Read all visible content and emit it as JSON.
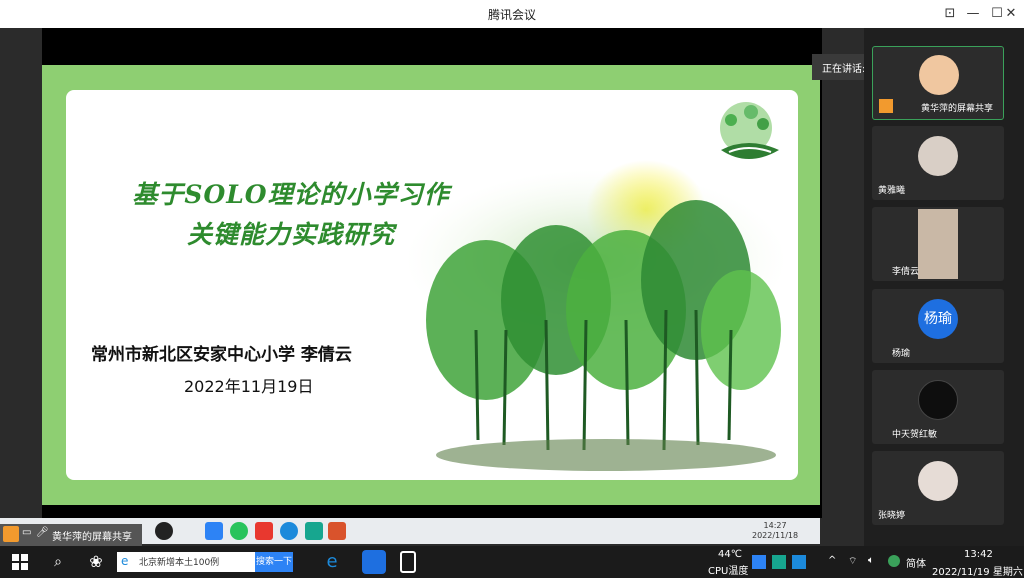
{
  "window": {
    "title": "腾讯会议"
  },
  "slide": {
    "title_line1": "基于SOLO理论的小学习作",
    "title_line2": "关键能力实践研究",
    "author": "常州市新北区安家中心小学  李倩云",
    "date": "2022年11月19日"
  },
  "speaking": {
    "label": "正在讲话: 黄华萍; 李倩云"
  },
  "participants": [
    {
      "name": "黄华萍的屏幕共享"
    },
    {
      "name": "黄雅曦"
    },
    {
      "name": "李倩云"
    },
    {
      "name": "杨瑜",
      "initials": "杨瑜"
    },
    {
      "name": "中天贺红敏"
    },
    {
      "name": "张晓婷"
    }
  ],
  "share_banner": {
    "label": "黄华萍的屏幕共享"
  },
  "inner_taskbar": {
    "time": "14:27",
    "date": "2022/11/18"
  },
  "taskbar": {
    "search_text": "北京新增本土100例",
    "search_button": "搜索一下",
    "temp": "44℃",
    "temp_label": "CPU温度",
    "ime": "简体",
    "time": "13:42",
    "date": "2022/11/19 星期六"
  }
}
